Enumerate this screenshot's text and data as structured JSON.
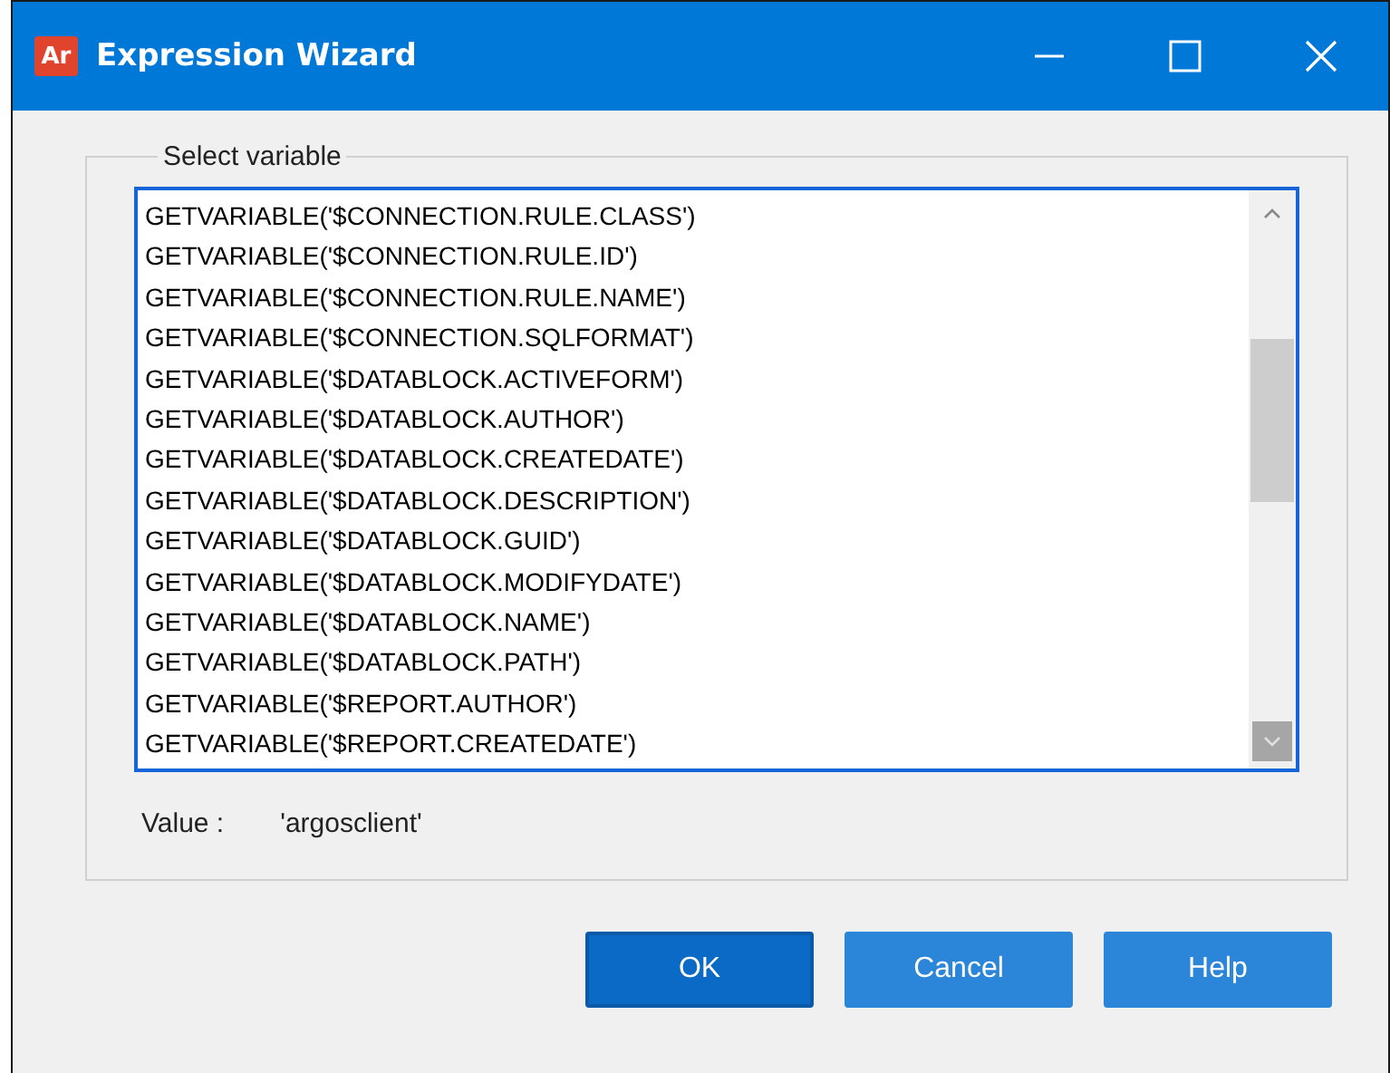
{
  "window": {
    "title": "Expression Wizard",
    "app_icon": "Ar"
  },
  "group": {
    "title": "Select variable"
  },
  "variables": [
    "GETVARIABLE('$CONNECTION.RULE.CLASS')",
    "GETVARIABLE('$CONNECTION.RULE.ID')",
    "GETVARIABLE('$CONNECTION.RULE.NAME')",
    "GETVARIABLE('$CONNECTION.SQLFORMAT')",
    "GETVARIABLE('$DATABLOCK.ACTIVEFORM')",
    "GETVARIABLE('$DATABLOCK.AUTHOR')",
    "GETVARIABLE('$DATABLOCK.CREATEDATE')",
    "GETVARIABLE('$DATABLOCK.DESCRIPTION')",
    "GETVARIABLE('$DATABLOCK.GUID')",
    "GETVARIABLE('$DATABLOCK.MODIFYDATE')",
    "GETVARIABLE('$DATABLOCK.NAME')",
    "GETVARIABLE('$DATABLOCK.PATH')",
    "GETVARIABLE('$REPORT.AUTHOR')",
    "GETVARIABLE('$REPORT.CREATEDATE')"
  ],
  "value": {
    "label": "Value :",
    "text": "'argosclient'"
  },
  "buttons": [
    {
      "label": "OK",
      "default": true
    },
    {
      "label": "Cancel",
      "default": false
    },
    {
      "label": "Help",
      "default": false
    }
  ]
}
